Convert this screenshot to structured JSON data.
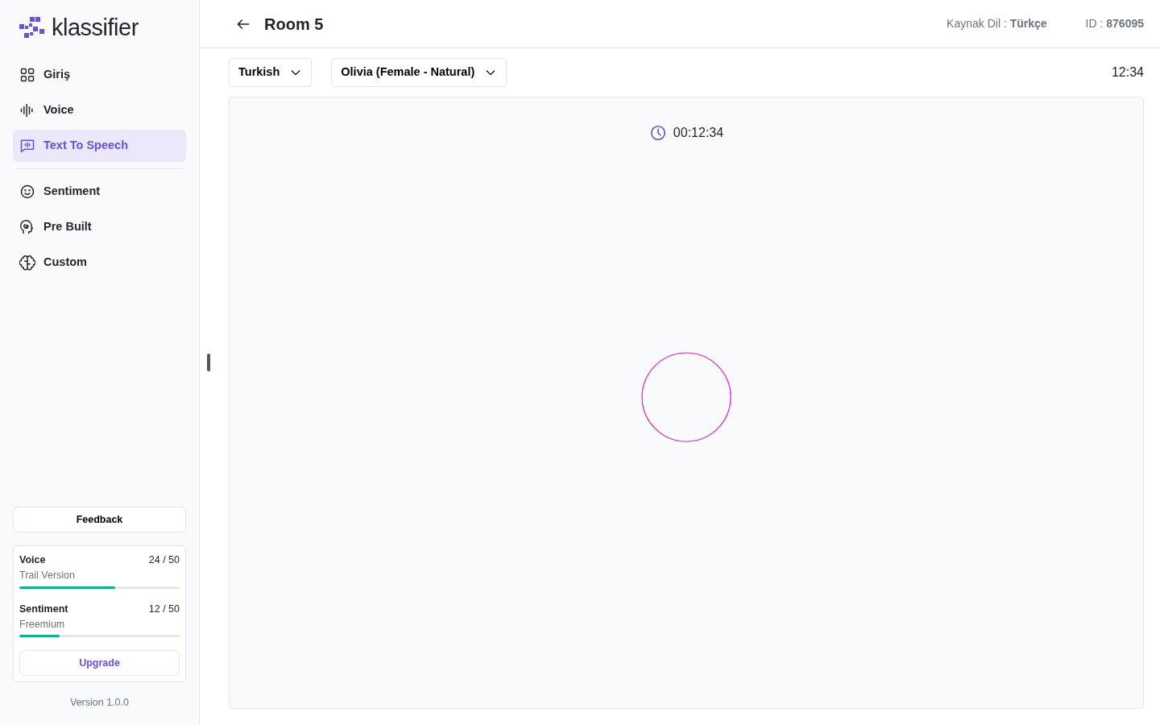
{
  "sidebar": {
    "logo": "klassifier",
    "nav_sections": [
      [
        {
          "label": "Giriş",
          "kind": "grid",
          "selected": false
        },
        {
          "label": "Voice",
          "kind": "wave",
          "selected": false
        },
        {
          "label": "Text To Speech",
          "kind": "speech",
          "selected": true
        }
      ],
      [
        {
          "label": "Sentiment",
          "kind": "smile",
          "selected": false
        },
        {
          "label": "Pre Built",
          "kind": "head",
          "selected": false
        },
        {
          "label": "Custom",
          "kind": "brain",
          "selected": false
        }
      ]
    ],
    "feedback_button": "Feedback",
    "usage": [
      {
        "name": "Voice",
        "plan": "Trail Version",
        "count": "24 / 50",
        "level": 0.6
      },
      {
        "name": "Sentiment",
        "plan": "Freemium",
        "count": "12 / 50",
        "level": 0.25
      }
    ],
    "upgrade_button": "Upgrade",
    "version": "Version 1.0.0"
  },
  "header": {
    "title": "Room 5",
    "meta": [
      "Kaynak Dil : **Türkçe**",
      "ID : **876095**"
    ]
  },
  "toolbar": {
    "dropdowns": [
      "Turkish",
      "Olivia (Female - Natural)"
    ],
    "time": "12:34"
  },
  "panel": {
    "timer": "00:12:34"
  }
}
